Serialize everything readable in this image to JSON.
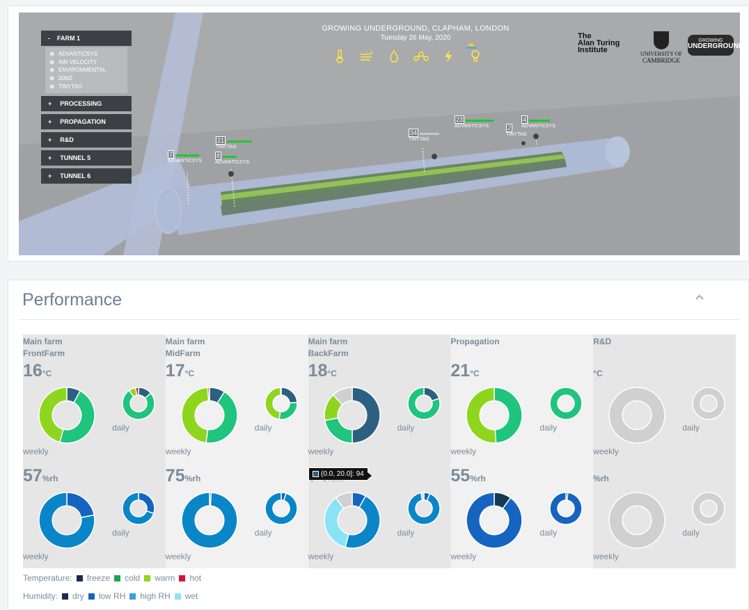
{
  "scene": {
    "title": "GROWING UNDERGROUND, CLAPHAM, LONDON",
    "date": "Tuesday 26 May, 2020",
    "menu": {
      "open_group": {
        "toggle": "-",
        "label": "FARM 1"
      },
      "sensors": [
        "ADVANTICSYS",
        "AIR VELOCITY",
        "ENVIRONMENTAL",
        "30MZ",
        "TINYTAG"
      ],
      "groups": [
        {
          "toggle": "+",
          "label": "PROCESSING"
        },
        {
          "toggle": "+",
          "label": "PROPAGATION"
        },
        {
          "toggle": "+",
          "label": "R&D"
        },
        {
          "toggle": "+",
          "label": "TUNNEL 5"
        },
        {
          "toggle": "+",
          "label": "TUNNEL 6"
        }
      ]
    },
    "icons": [
      "thermometer-icon",
      "wind-icon",
      "drop-icon",
      "molecule-icon",
      "lightning-icon",
      "bulb-icon"
    ],
    "logos": {
      "turing": [
        "The",
        "Alan Turing",
        "Institute"
      ],
      "cambridge": [
        "UNIVERSITY OF",
        "CAMBRIDGE"
      ],
      "gu": [
        "GROWING",
        "UNDERGROUND"
      ]
    },
    "markers": [
      {
        "num": "7",
        "label": "ADVANTICSYS"
      },
      {
        "num": "21",
        "label": "TINYTAG"
      },
      {
        "num": "8",
        "label": "ADVANTICSYS"
      },
      {
        "num": "34",
        "label": "TINYTAG"
      },
      {
        "num": "23",
        "label": "ADVANTICSYS"
      },
      {
        "num": "4",
        "label": "ADVANTICSYS"
      },
      {
        "num": "2",
        "label": "TINYTAG"
      }
    ],
    "colors": {
      "accent_icon": "#ffe93b",
      "sensor_bar": "#21c62e"
    }
  },
  "performance": {
    "title": "Performance",
    "columns": [
      {
        "name": "Main farm",
        "sub": "FrontFarm",
        "temp": "16",
        "temp_unit": "°C",
        "hum": "57",
        "hum_unit": "%rh"
      },
      {
        "name": "Main farm",
        "sub": "MidFarm",
        "temp": "17",
        "temp_unit": "°C",
        "hum": "75",
        "hum_unit": "%rh"
      },
      {
        "name": "Main farm",
        "sub": "BackFarm",
        "temp": "18",
        "temp_unit": "°C",
        "hum": "74",
        "hum_unit": "%rh"
      },
      {
        "name": "Propagation",
        "sub": "",
        "temp": "21",
        "temp_unit": "°C",
        "hum": "55",
        "hum_unit": "%rh"
      },
      {
        "name": "R&D",
        "sub": "",
        "temp": "",
        "temp_unit": "°C",
        "hum": "",
        "hum_unit": "%rh"
      }
    ],
    "period_labels": {
      "weekly": "weekly",
      "daily": "daily"
    },
    "tooltip": "(0.0, 20.0]: 94",
    "legend": {
      "temperature": {
        "label": "Temperature:",
        "items": [
          {
            "name": "freeze",
            "color": "#1b2a52"
          },
          {
            "name": "cold",
            "color": "#19a64f"
          },
          {
            "name": "warm",
            "color": "#8ed61e"
          },
          {
            "name": "hot",
            "color": "#d3123a"
          }
        ]
      },
      "humidity": {
        "label": "Humidity:",
        "items": [
          {
            "name": "dry",
            "color": "#1b2a52"
          },
          {
            "name": "low RH",
            "color": "#1565c0"
          },
          {
            "name": "high RH",
            "color": "#3d9de0"
          },
          {
            "name": "wet",
            "color": "#8ae3f5"
          }
        ]
      }
    },
    "chart_data": [
      {
        "type": "pie",
        "title": "FrontFarm temperature weekly",
        "slices": [
          {
            "name": "freeze",
            "value": 8
          },
          {
            "name": "cold",
            "value": 46
          },
          {
            "name": "warm",
            "value": 46
          }
        ]
      },
      {
        "type": "pie",
        "title": "FrontFarm temperature daily",
        "slices": [
          {
            "name": "freeze",
            "value": 14
          },
          {
            "name": "cold",
            "value": 76
          },
          {
            "name": "warm",
            "value": 7
          },
          {
            "name": "hot",
            "value": 3
          }
        ]
      },
      {
        "type": "pie",
        "title": "MidFarm temperature weekly",
        "slices": [
          {
            "name": "freeze",
            "value": 9
          },
          {
            "name": "cold",
            "value": 43
          },
          {
            "name": "warm",
            "value": 47
          },
          {
            "name": "hot",
            "value": 1
          }
        ]
      },
      {
        "type": "pie",
        "title": "MidFarm temperature daily",
        "slices": [
          {
            "name": "freeze",
            "value": 24
          },
          {
            "name": "cold",
            "value": 28
          },
          {
            "name": "warm",
            "value": 47
          },
          {
            "name": "hot",
            "value": 1
          }
        ]
      },
      {
        "type": "pie",
        "title": "BackFarm temperature weekly",
        "slices": [
          {
            "name": "freeze",
            "value": 50
          },
          {
            "name": "cold",
            "value": 22
          },
          {
            "name": "warm",
            "value": 16
          },
          {
            "name": "other",
            "value": 12
          }
        ]
      },
      {
        "type": "pie",
        "title": "BackFarm temperature daily",
        "slices": [
          {
            "name": "freeze",
            "value": 20
          },
          {
            "name": "cold",
            "value": 80
          }
        ]
      },
      {
        "type": "pie",
        "title": "Propagation temperature weekly",
        "slices": [
          {
            "name": "cold",
            "value": 49
          },
          {
            "name": "warm",
            "value": 51
          }
        ]
      },
      {
        "type": "pie",
        "title": "Propagation temperature daily",
        "slices": [
          {
            "name": "cold",
            "value": 100
          }
        ]
      },
      {
        "type": "pie",
        "title": "R&D temperature weekly",
        "slices": [
          {
            "name": "none",
            "value": 100
          }
        ]
      },
      {
        "type": "pie",
        "title": "R&D temperature daily",
        "slices": [
          {
            "name": "none",
            "value": 100
          }
        ]
      },
      {
        "type": "pie",
        "title": "FrontFarm humidity weekly",
        "slices": [
          {
            "name": "low RH",
            "value": 22
          },
          {
            "name": "high RH",
            "value": 78
          }
        ]
      },
      {
        "type": "pie",
        "title": "FrontFarm humidity daily",
        "slices": [
          {
            "name": "low RH",
            "value": 30
          },
          {
            "name": "high RH",
            "value": 70
          }
        ]
      },
      {
        "type": "pie",
        "title": "MidFarm humidity weekly",
        "slices": [
          {
            "name": "low RH",
            "value": 1
          },
          {
            "name": "high RH",
            "value": 99
          }
        ]
      },
      {
        "type": "pie",
        "title": "MidFarm humidity daily",
        "slices": [
          {
            "name": "low RH",
            "value": 5
          },
          {
            "name": "high RH",
            "value": 95
          }
        ]
      },
      {
        "type": "pie",
        "title": "BackFarm humidity weekly",
        "slices": [
          {
            "name": "low RH",
            "value": 8
          },
          {
            "name": "high RH",
            "value": 46
          },
          {
            "name": "wet",
            "value": 36
          },
          {
            "name": "other",
            "value": 10
          }
        ]
      },
      {
        "type": "pie",
        "title": "BackFarm humidity daily",
        "slices": [
          {
            "name": "low RH",
            "value": 6
          },
          {
            "name": "high RH",
            "value": 91
          },
          {
            "name": "other",
            "value": 3
          }
        ]
      },
      {
        "type": "pie",
        "title": "Propagation humidity weekly",
        "slices": [
          {
            "name": "dry",
            "value": 10
          },
          {
            "name": "low RH",
            "value": 90
          }
        ]
      },
      {
        "type": "pie",
        "title": "Propagation humidity daily",
        "slices": [
          {
            "name": "dry",
            "value": 2
          },
          {
            "name": "low RH",
            "value": 98
          }
        ]
      },
      {
        "type": "pie",
        "title": "R&D humidity weekly",
        "slices": [
          {
            "name": "none",
            "value": 100
          }
        ]
      },
      {
        "type": "pie",
        "title": "R&D humidity daily",
        "slices": [
          {
            "name": "none",
            "value": 100
          }
        ]
      }
    ],
    "slice_colors": {
      "freeze": "#2d5f80",
      "cold": "#1fc47d",
      "warm": "#8ed61e",
      "hot": "#d3123a",
      "dry": "#163a52",
      "low RH": "#1565c0",
      "high RH": "#0a86c8",
      "wet": "#8ae3f5",
      "other": "#d0d0d0",
      "none": "#d0d0d0"
    }
  }
}
